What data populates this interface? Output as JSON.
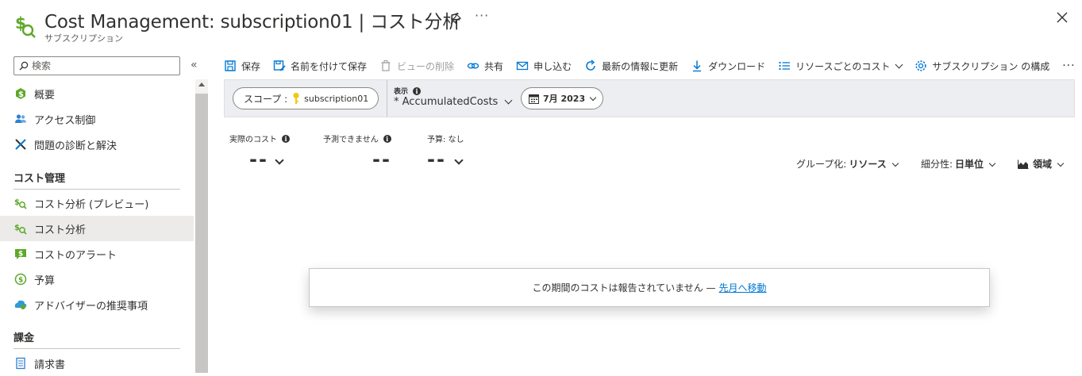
{
  "header": {
    "title": "Cost Management: subscription01 | コスト分析",
    "subtitle": "サブスクリプション",
    "more": "···"
  },
  "sidebar": {
    "search_placeholder": "検索",
    "collapse": "«",
    "items_top": [
      {
        "label": "概要",
        "icon": "cost-dollar-icon"
      },
      {
        "label": "アクセス制御",
        "icon": "people-icon"
      },
      {
        "label": "問題の診断と解決",
        "icon": "wrench-icon"
      }
    ],
    "section_cost": "コスト管理",
    "items_cost": [
      {
        "label": "コスト分析 (プレビュー)",
        "icon": "cost-analysis-icon"
      },
      {
        "label": "コスト分析",
        "icon": "cost-analysis-icon",
        "selected": true
      },
      {
        "label": "コストのアラート",
        "icon": "alert-dollar-icon"
      },
      {
        "label": "予算",
        "icon": "budget-icon"
      },
      {
        "label": "アドバイザーの推奨事項",
        "icon": "advisor-icon"
      }
    ],
    "section_billing": "課金",
    "items_billing": [
      {
        "label": "請求書",
        "icon": "invoice-icon"
      }
    ]
  },
  "toolbar": {
    "save": "保存",
    "save_as": "名前を付けて保存",
    "delete_view": "ビューの削除",
    "share": "共有",
    "subscribe": "申し込む",
    "refresh": "最新の情報に更新",
    "download": "ダウンロード",
    "cost_by_resource": "リソースごとのコスト",
    "configure": "サブスクリプション の構成",
    "more": "···"
  },
  "filters": {
    "scope_label": "スコープ :",
    "scope_value": "subscription01",
    "view_label": "表示",
    "view_value": "* AccumulatedCosts",
    "date_value": "7月 2023"
  },
  "kpis": {
    "actual_label": "実際のコスト",
    "actual_value": "--",
    "forecast_label": "予測できません",
    "forecast_value": "--",
    "budget_label": "予算: なし",
    "budget_value": "--"
  },
  "controls": {
    "group_label": "グループ化:",
    "group_value": "リソース",
    "granularity_label": "細分性:",
    "granularity_value": "日単位",
    "chart_type": "領域"
  },
  "message": {
    "text": "この期間のコストは報告されていません —",
    "link": "先月へ移動"
  },
  "colors": {
    "accent": "#0078d4",
    "cost_green": "#5ea829",
    "selected_bg": "#edebe9",
    "filterbar_bg": "#eceef1"
  }
}
